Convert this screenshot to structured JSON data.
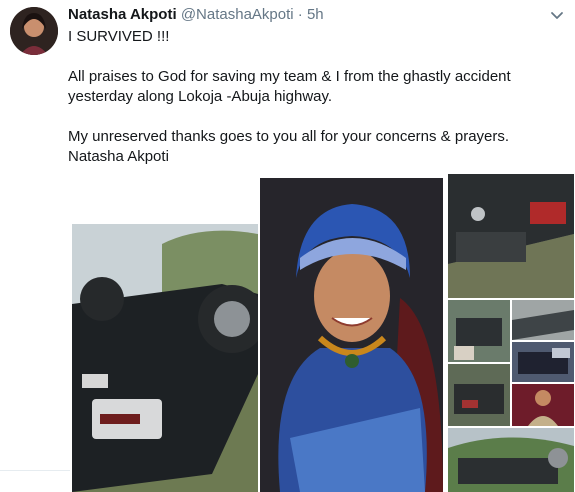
{
  "tweet": {
    "author_name": "Natasha Akpoti",
    "author_handle": "@NatashaAkpoti",
    "separator": "·",
    "time": "5h",
    "lines": [
      "I SURVIVED !!!",
      "All praises to God for saving my team & I from the ghastly accident yesterday along Lokoja -Abuja highway.",
      "My unreserved thanks goes to you all for your concerns & prayers.",
      "Natasha Akpoti"
    ]
  },
  "icons": {
    "caret": "chevron-down-icon"
  },
  "colors": {
    "text": "#14171a",
    "muted": "#657786"
  }
}
